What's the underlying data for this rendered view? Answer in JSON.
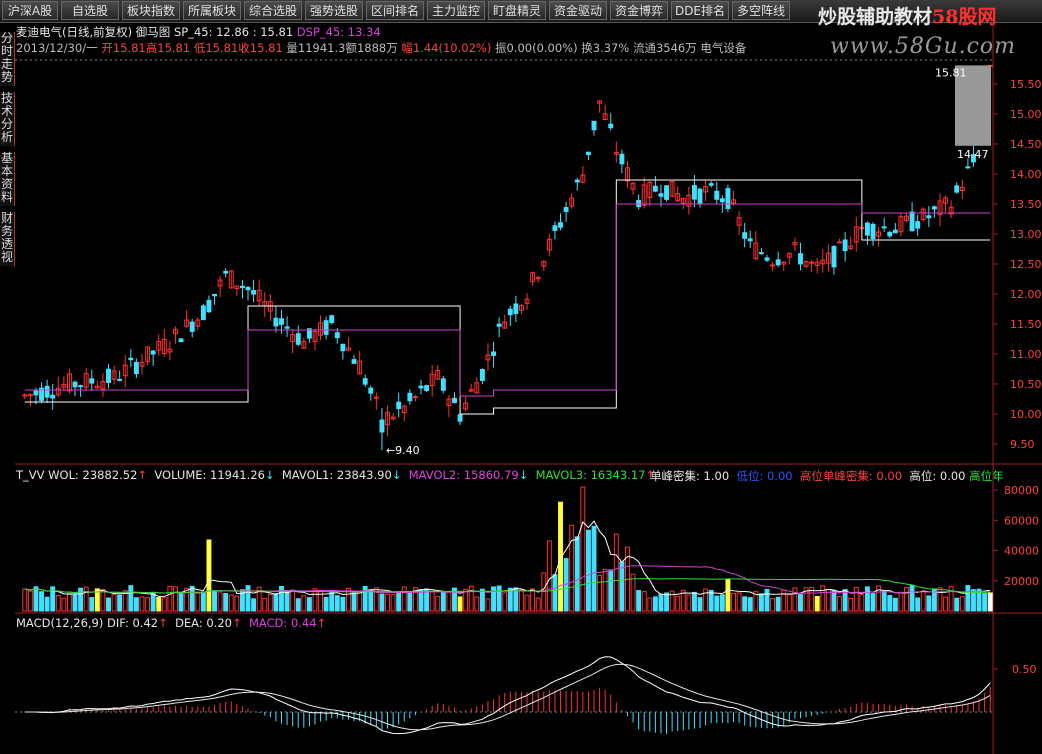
{
  "toolbar": {
    "buttons": [
      "沪深A股",
      "自选股",
      "板块指数",
      "所属板块",
      "综合选股",
      "强势选股",
      "区间排名",
      "主力监控",
      "盯盘精灵",
      "资金驱动",
      "资金博弈",
      "DDE排名",
      "多空阵线"
    ]
  },
  "watermark": {
    "text_main": "炒股辅助教材",
    "text_num": "58股网",
    "url": "www.58Gu.com"
  },
  "side_tabs": [
    "分时走势",
    "技术分析",
    "基本资料",
    "财务透视"
  ],
  "header": {
    "title": "麦迪电气(日线,前复权)",
    "indicator": "御马图",
    "sp_label": "SP_45: 12.86",
    "sp_extra": ": 15.81",
    "dsp_label": "DSP_45: 13.34",
    "date": "2013/12/30/一",
    "open": "开15.81",
    "high": "高15.81",
    "low": "低15.81",
    "close": "收15.81",
    "vol": "量11941.3",
    "amount": "额1888万",
    "change": "幅1.44(10.02%)",
    "amp": "振0.00(0.00%)",
    "turnover": "换3.37%",
    "float": "流通3546万",
    "sector": "电气设备"
  },
  "vol_header": {
    "name": "T_VV",
    "wol": "WOL: 23882.52",
    "volume": "VOLUME: 11941.26",
    "mavol1": "MAVOL1: 23843.90",
    "mavol2": "MAVOL2: 15860.79",
    "mavol3": "MAVOL3: 16343.17",
    "single_peak": "单峰密集: 1.00",
    "low_pos": "低位: 0.00",
    "high_pos_single": "高位单峰密集: 0.00",
    "high_pos": "高位: 0.00",
    "high_year": "高位年"
  },
  "macd_header": {
    "name": "MACD(12,26,9)",
    "dif": "DIF: 0.42",
    "dea": "DEA: 0.20",
    "macd": "MACD: 0.44"
  },
  "price_axis": {
    "ticks": [
      "15.50",
      "15.00",
      "14.50",
      "14.00",
      "13.50",
      "13.00",
      "12.50",
      "12.00",
      "11.50",
      "11.00",
      "10.50",
      "10.00",
      "9.50"
    ],
    "ylim": [
      9.2,
      15.9
    ]
  },
  "vol_axis": {
    "ticks": [
      "80000",
      "60000",
      "40000",
      "20000"
    ],
    "ylim": [
      0,
      88000
    ]
  },
  "macd_axis": {
    "ticks": [
      "0.50"
    ]
  },
  "annotations": {
    "max_label": "15.81",
    "min_label": "9.40",
    "box_label": "14.47"
  },
  "colors": {
    "up": "#ff3030",
    "down": "#40e0ff",
    "axis": "#a02020",
    "line_white": "#ffffff",
    "line_magenta": "#d040d0",
    "bar_yellow": "#ffff40"
  }
}
